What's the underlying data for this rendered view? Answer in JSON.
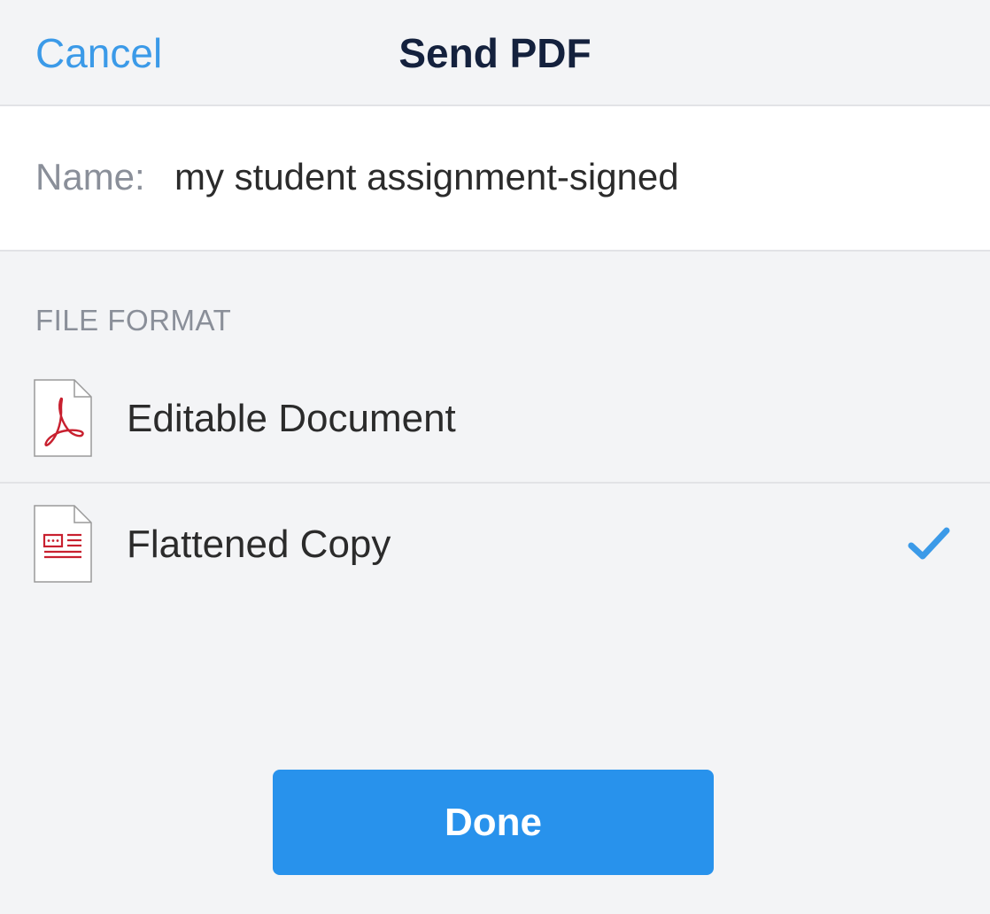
{
  "nav": {
    "cancel_label": "Cancel",
    "title": "Send PDF"
  },
  "name_field": {
    "label": "Name:",
    "value": "my student assignment-signed"
  },
  "file_format": {
    "header": "FILE FORMAT",
    "options": [
      {
        "label": "Editable Document",
        "icon": "pdf-document-icon",
        "selected": false
      },
      {
        "label": "Flattened Copy",
        "icon": "flattened-document-icon",
        "selected": true
      }
    ]
  },
  "done_label": "Done",
  "colors": {
    "accent": "#2892ec",
    "link": "#3b9ae8",
    "icon_red": "#c8202f",
    "title": "#14213d"
  }
}
